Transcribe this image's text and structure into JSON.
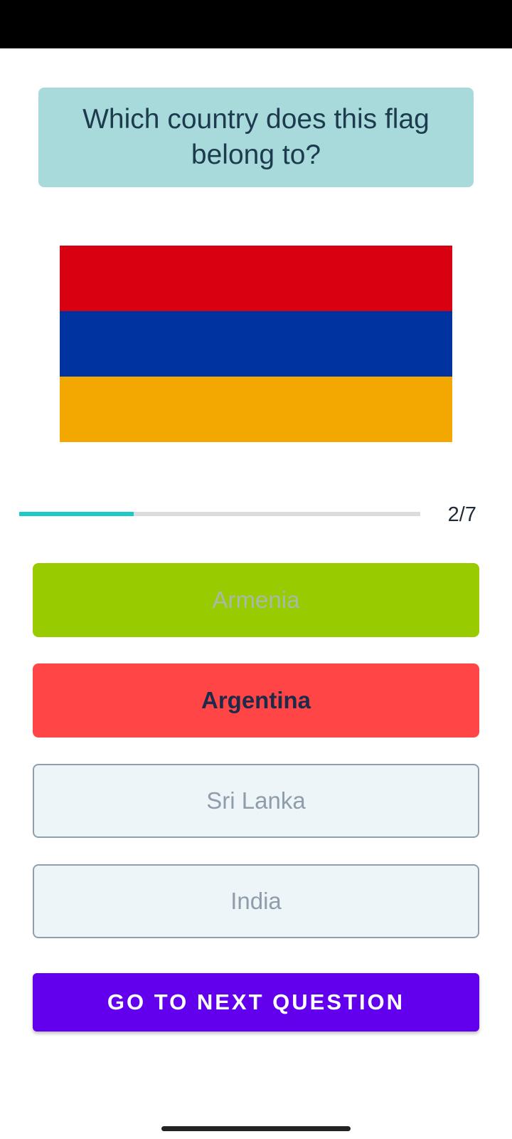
{
  "question": {
    "text": "Which country does this flag belong to?"
  },
  "flag": {
    "stripes": [
      "#d90012",
      "#0033a0",
      "#f2a800"
    ]
  },
  "progress": {
    "current": 2,
    "total": 7,
    "label": "2/7",
    "fraction": 0.2857
  },
  "options": [
    {
      "label": "Armenia",
      "state": "correct"
    },
    {
      "label": "Argentina",
      "state": "wrong"
    },
    {
      "label": "Sri Lanka",
      "state": "neutral"
    },
    {
      "label": "India",
      "state": "neutral"
    }
  ],
  "next_button": {
    "label": "GO TO NEXT QUESTION"
  },
  "colors": {
    "question_card": "#a8dadc",
    "progress_fill": "#1cc9c4",
    "correct": "#99cc00",
    "wrong": "#ff4545",
    "primary": "#6200ee"
  }
}
